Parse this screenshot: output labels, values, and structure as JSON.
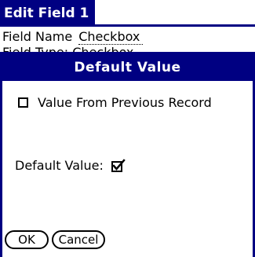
{
  "app_title": "Edit Field 1",
  "field": {
    "label": "Field Name",
    "value": "Checkbox"
  },
  "hidden_row_text": "Field Type:              Checkbox",
  "dialog": {
    "title": "Default Value",
    "option_label": "Value From Previous Record",
    "option_checked": false,
    "default_label": "Default Value:",
    "default_checked": true,
    "ok_label": "OK",
    "cancel_label": "Cancel"
  },
  "colors": {
    "title_bg": "#000082",
    "title_fg": "#ffffff"
  }
}
